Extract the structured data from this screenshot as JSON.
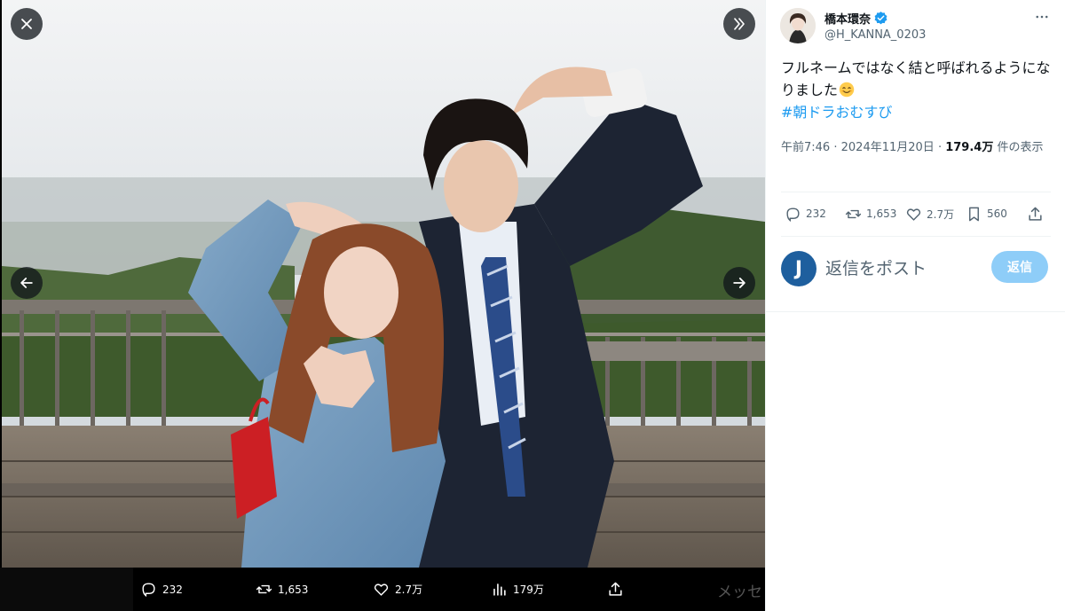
{
  "viewer": {
    "close_icon": "close-icon",
    "expand_icon": "chevrons-right-icon",
    "prev_icon": "arrow-left-icon",
    "next_icon": "arrow-right-icon",
    "stats": {
      "replies": "232",
      "reposts": "1,653",
      "likes": "2.7万",
      "views": "179万"
    },
    "behind_text": "メッセ"
  },
  "post": {
    "author_name": "橋本環奈",
    "author_handle": "@H_KANNA_0203",
    "text": "フルネームではなく結と呼ばれるようになりました",
    "emoji": "smiling-face-emoji",
    "hashtag": "#朝ドラおむすび",
    "time": "午前7:46",
    "date": "2024年11月20日",
    "views_count": "179.4万",
    "views_suffix": "件の表示",
    "meta_sep": "·"
  },
  "actions": {
    "replies": "232",
    "reposts": "1,653",
    "likes": "2.7万",
    "bookmarks": "560"
  },
  "reply_box": {
    "avatar_letter": "J",
    "placeholder": "返信をポスト",
    "button_label": "返信"
  },
  "colors": {
    "accent": "#1d9bf0",
    "reply_button": "#8ecdf8",
    "muted_text": "#536471",
    "viewer_bg": "#000000",
    "verified": "#1d9bf0"
  }
}
